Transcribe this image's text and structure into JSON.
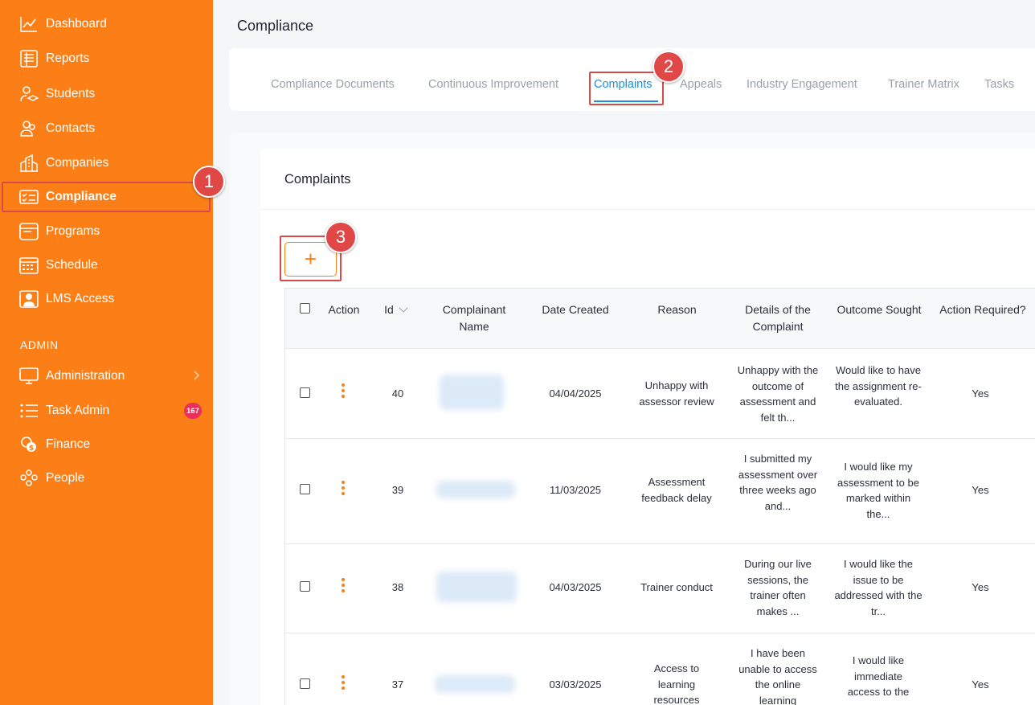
{
  "sidebar": {
    "items": [
      {
        "label": "Dashboard",
        "icon": "chart-line-icon"
      },
      {
        "label": "Reports",
        "icon": "report-icon"
      },
      {
        "label": "Students",
        "icon": "student-icon"
      },
      {
        "label": "Contacts",
        "icon": "contacts-icon"
      },
      {
        "label": "Companies",
        "icon": "building-icon"
      },
      {
        "label": "Compliance",
        "icon": "checklist-icon",
        "active": true
      },
      {
        "label": "Programs",
        "icon": "browser-icon"
      },
      {
        "label": "Schedule",
        "icon": "calendar-icon"
      },
      {
        "label": "LMS Access",
        "icon": "user-screen-icon"
      }
    ],
    "admin_heading": "ADMIN",
    "admin_items": [
      {
        "label": "Administration",
        "icon": "monitor-icon"
      },
      {
        "label": "Task Admin",
        "icon": "list-icon",
        "badge": "167"
      },
      {
        "label": "Finance",
        "icon": "coins-icon"
      },
      {
        "label": "People",
        "icon": "people-icon"
      }
    ]
  },
  "page": {
    "title": "Compliance"
  },
  "tabs": [
    {
      "label": "Compliance Documents"
    },
    {
      "label": "Continuous Improvement"
    },
    {
      "label": "Complaints",
      "active": true
    },
    {
      "label": "Appeals"
    },
    {
      "label": "Industry Engagement"
    },
    {
      "label": "Trainer Matrix"
    },
    {
      "label": "Tasks"
    }
  ],
  "section": {
    "title": "Complaints",
    "add_label": "+"
  },
  "callouts": {
    "one": "1",
    "two": "2",
    "three": "3"
  },
  "table": {
    "headers": {
      "action": "Action",
      "id": "Id",
      "name": "Complainant Name",
      "date": "Date Created",
      "reason": "Reason",
      "details": "Details of the Complaint",
      "outcome": "Outcome Sought",
      "required": "Action Required?"
    },
    "rows": [
      {
        "id": "40",
        "date": "04/04/2025",
        "reason": "Unhappy with assessor review",
        "details": "Unhappy with the outcome of assessment and felt th...",
        "outcome": "Would like to have the assignment re-evaluated.",
        "required": "Yes"
      },
      {
        "id": "39",
        "date": "11/03/2025",
        "reason": "Assessment feedback delay",
        "details": "I submitted my assessment over three weeks ago and...",
        "outcome": "I would like my assessment to be marked within the...",
        "required": "Yes"
      },
      {
        "id": "38",
        "date": "04/03/2025",
        "reason": "Trainer conduct",
        "details": "During our live sessions, the trainer often makes ...",
        "outcome": "I would like the issue to be addressed with the tr...",
        "required": "Yes"
      },
      {
        "id": "37",
        "date": "03/03/2025",
        "reason": "Access to learning resources",
        "details": "I have been unable to access the online learning",
        "outcome": "I would like immediate access to the",
        "required": "Yes"
      }
    ]
  },
  "colors": {
    "brand": "#fb7f16",
    "link": "#1e8fd6",
    "highlight": "#d8494a",
    "badge": "#e8305a"
  }
}
